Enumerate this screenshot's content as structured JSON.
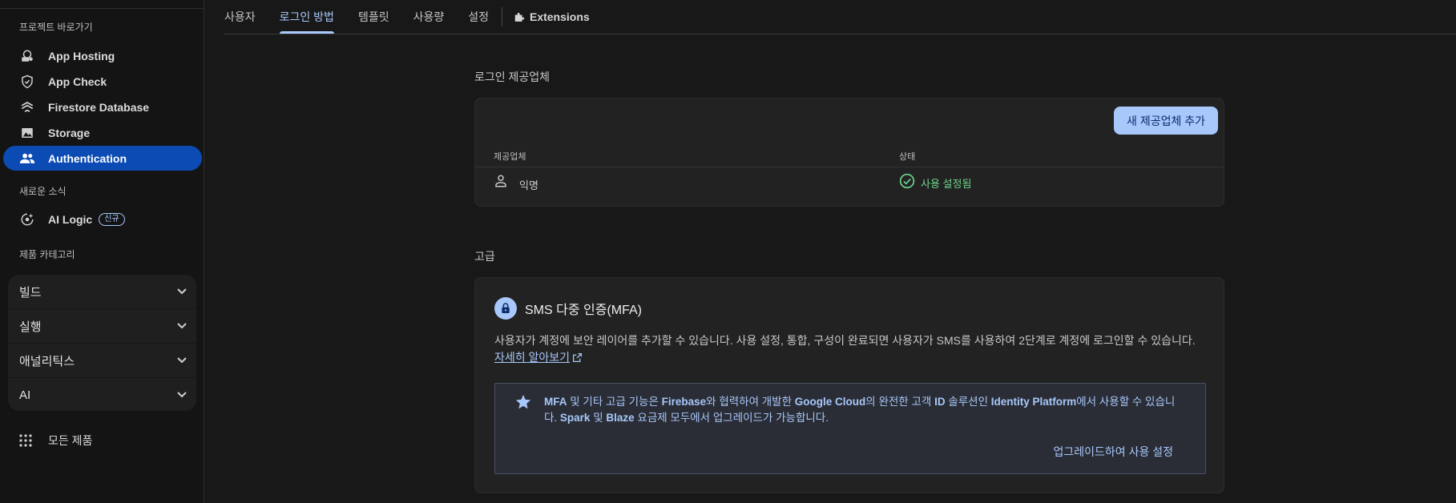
{
  "sidebar": {
    "section_shortcuts": "프로젝트 바로가기",
    "shortcuts": [
      {
        "label": "App Hosting",
        "icon": "app-hosting-icon"
      },
      {
        "label": "App Check",
        "icon": "shield-icon"
      },
      {
        "label": "Firestore Database",
        "icon": "firestore-icon"
      },
      {
        "label": "Storage",
        "icon": "image-icon"
      },
      {
        "label": "Authentication",
        "icon": "people-icon",
        "active": true
      }
    ],
    "section_news": "새로운 소식",
    "news_item": {
      "label": "AI Logic",
      "badge": "신규",
      "icon": "ai-logic-icon"
    },
    "section_categories": "제품 카테고리",
    "categories": [
      "빌드",
      "실행",
      "애널리틱스",
      "AI"
    ],
    "all_products": "모든 제품"
  },
  "tabs": [
    {
      "label": "사용자"
    },
    {
      "label": "로그인 방법",
      "active": true
    },
    {
      "label": "템플릿"
    },
    {
      "label": "사용량"
    },
    {
      "label": "설정"
    },
    {
      "label": "Extensions",
      "icon": "extensions-icon"
    }
  ],
  "providers": {
    "title": "로그인 제공업체",
    "add_button": "새 제공업체 추가",
    "col_provider": "제공업체",
    "col_status": "상태",
    "rows": [
      {
        "name": "익명",
        "status": "사용 설정됨",
        "status_color": "#6dd58c"
      }
    ]
  },
  "advanced": {
    "title": "고급",
    "mfa_title": "SMS 다중 인증(MFA)",
    "mfa_desc": "사용자가 계정에 보안 레이어를 추가할 수 있습니다. 사용 설정, 통합, 구성이 완료되면 사용자가 SMS를 사용하여 2단계로 계정에 로그인할 수 있습니다.",
    "learn_more": "자세히 알아보기",
    "info": {
      "t1": "MFA",
      "t2": " 및 기타 고급 기능은 ",
      "t3": "Firebase",
      "t4": "와 협력하여 개발한 ",
      "t5": "Google Cloud",
      "t6": "의 완전한 고객 ",
      "t7": "ID",
      "t8": " 솔루션인 ",
      "t9": "Identity Platform",
      "t10": "에서 사용할 수 있습니다. ",
      "t11": "Spark",
      "t12": " 및 ",
      "t13": "Blaze",
      "t14": " 요금제 모두에서 업그레이드가 가능합니다."
    },
    "upgrade_action": "업그레이드하여 사용 설정"
  },
  "colors": {
    "accent": "#a8c7fa",
    "active_nav": "#0b4bb3",
    "success": "#6dd58c"
  }
}
